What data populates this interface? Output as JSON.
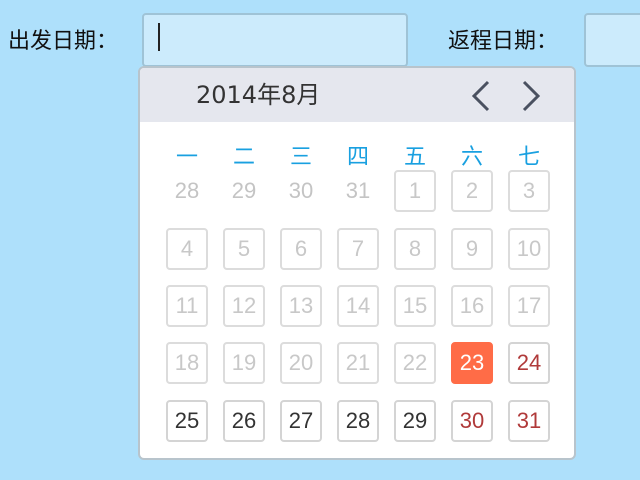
{
  "form": {
    "departure_label": "出发日期：",
    "return_label": "返程日期："
  },
  "calendar": {
    "month_title": "2014年8月",
    "prev_icon": "chevron-left-icon",
    "next_icon": "chevron-right-icon",
    "weekdays": [
      "一",
      "二",
      "三",
      "四",
      "五",
      "六",
      "七"
    ],
    "weeks": [
      [
        {
          "d": "28",
          "s": "outside"
        },
        {
          "d": "29",
          "s": "outside"
        },
        {
          "d": "30",
          "s": "outside"
        },
        {
          "d": "31",
          "s": "outside"
        },
        {
          "d": "1",
          "s": "disabled"
        },
        {
          "d": "2",
          "s": "disabled"
        },
        {
          "d": "3",
          "s": "disabled"
        }
      ],
      [
        {
          "d": "4",
          "s": "disabled"
        },
        {
          "d": "5",
          "s": "disabled"
        },
        {
          "d": "6",
          "s": "disabled"
        },
        {
          "d": "7",
          "s": "disabled"
        },
        {
          "d": "8",
          "s": "disabled"
        },
        {
          "d": "9",
          "s": "disabled"
        },
        {
          "d": "10",
          "s": "disabled"
        }
      ],
      [
        {
          "d": "11",
          "s": "disabled"
        },
        {
          "d": "12",
          "s": "disabled"
        },
        {
          "d": "13",
          "s": "disabled"
        },
        {
          "d": "14",
          "s": "disabled"
        },
        {
          "d": "15",
          "s": "disabled"
        },
        {
          "d": "16",
          "s": "disabled"
        },
        {
          "d": "17",
          "s": "disabled"
        }
      ],
      [
        {
          "d": "18",
          "s": "disabled"
        },
        {
          "d": "19",
          "s": "disabled"
        },
        {
          "d": "20",
          "s": "disabled"
        },
        {
          "d": "21",
          "s": "disabled"
        },
        {
          "d": "22",
          "s": "disabled"
        },
        {
          "d": "23",
          "s": "today"
        },
        {
          "d": "24",
          "s": "weekend"
        }
      ],
      [
        {
          "d": "25",
          "s": "enabled"
        },
        {
          "d": "26",
          "s": "enabled"
        },
        {
          "d": "27",
          "s": "enabled"
        },
        {
          "d": "28",
          "s": "enabled"
        },
        {
          "d": "29",
          "s": "enabled"
        },
        {
          "d": "30",
          "s": "weekend"
        },
        {
          "d": "31",
          "s": "weekend"
        }
      ]
    ]
  },
  "colors": {
    "background": "#aee0fb",
    "today": "#ff6c47",
    "weekday_header": "#19a0e0",
    "weekend_text": "#b03a3a"
  }
}
